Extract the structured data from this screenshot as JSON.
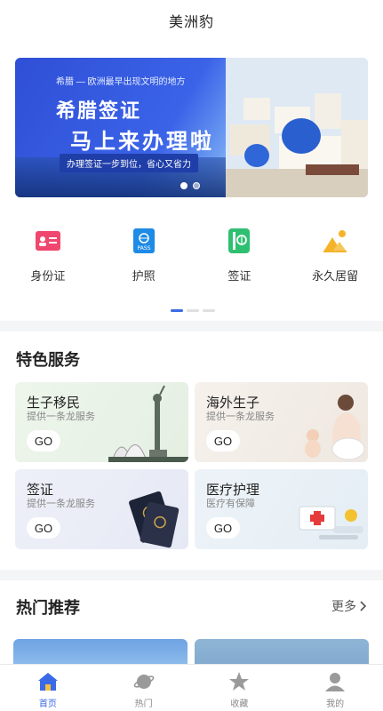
{
  "header": {
    "title": "美洲豹"
  },
  "banner": {
    "subtitle": "希腊 — 欧洲最早出现文明的地方",
    "headline1": "希腊签证",
    "headline2": "马上来办理啦",
    "tagline": "办理签证一步到位，省心又省力"
  },
  "quick_menu": [
    {
      "label": "身份证",
      "icon": "id-card-icon",
      "color": "#f0476e"
    },
    {
      "label": "护照",
      "icon": "passport-icon",
      "color": "#1e8be6"
    },
    {
      "label": "签证",
      "icon": "visa-icon",
      "color": "#2fbf71"
    },
    {
      "label": "永久居留",
      "icon": "landscape-icon",
      "color": "#f5b32a"
    }
  ],
  "services": {
    "title": "特色服务",
    "cards": [
      {
        "title": "生子移民",
        "subtitle": "提供一条龙服务",
        "button": "GO"
      },
      {
        "title": "海外生子",
        "subtitle": "提供一条龙服务",
        "button": "GO"
      },
      {
        "title": "签证",
        "subtitle": "提供一条龙服务",
        "button": "GO"
      },
      {
        "title": "医疗护理",
        "subtitle": "医疗有保障",
        "button": "GO"
      }
    ]
  },
  "hot": {
    "title": "热门推荐",
    "more": "更多"
  },
  "tabbar": [
    {
      "label": "首页",
      "icon": "home-icon",
      "active": true
    },
    {
      "label": "热门",
      "icon": "planet-icon",
      "active": false
    },
    {
      "label": "收藏",
      "icon": "star-icon",
      "active": false
    },
    {
      "label": "我的",
      "icon": "user-icon",
      "active": false
    }
  ],
  "colors": {
    "accent": "#3b6ae6",
    "banner_blue": "#3a63e8"
  }
}
